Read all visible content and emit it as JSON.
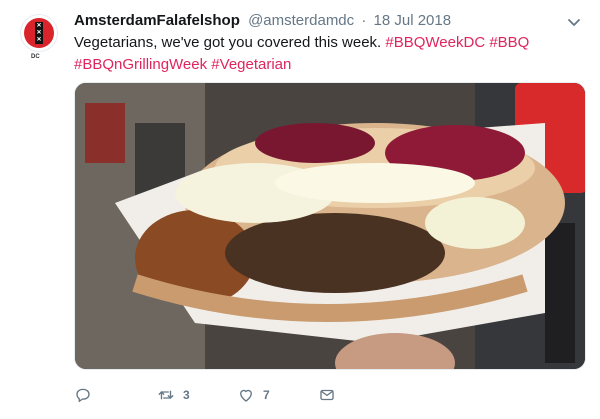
{
  "tweet": {
    "display_name": "AmsterdamFalafelshop",
    "handle": "@amsterdamdc",
    "separator": "·",
    "date": "18 Jul 2018",
    "avatar_tag": "DC",
    "text_plain": "Vegetarians, we've got you covered this week.",
    "hashtags": [
      "#BBQWeekDC",
      "#BBQ",
      "#BBQnGrillingWeek",
      "#Vegetarian"
    ],
    "accent_color": "#e0245e"
  },
  "media": {
    "subject": "falafel pita sandwich with beets and white sauce held in hand"
  },
  "actions": {
    "reply": {
      "icon": "reply-icon",
      "count": ""
    },
    "retweet": {
      "icon": "retweet-icon",
      "count": "3"
    },
    "like": {
      "icon": "heart-icon",
      "count": "7"
    },
    "message": {
      "icon": "envelope-icon",
      "count": ""
    }
  }
}
